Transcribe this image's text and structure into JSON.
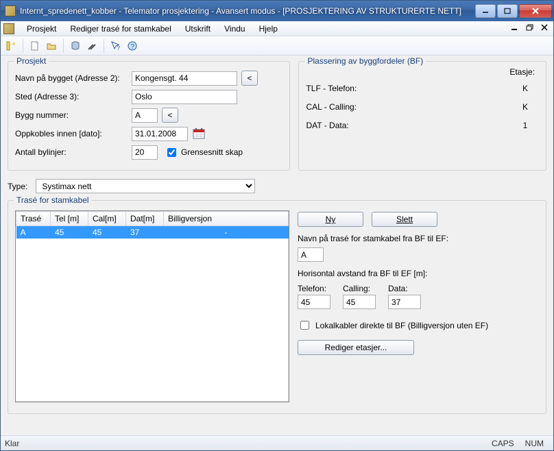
{
  "title": "Internt_spredenett_kobber - Telemator prosjektering - Avansert modus - [PROSJEKTERING AV STRUKTURERTE NETT]",
  "menu": {
    "items": [
      "Prosjekt",
      "Rediger trasé for stamkabel",
      "Utskrift",
      "Vindu",
      "Hjelp"
    ]
  },
  "project_group": {
    "title": "Prosjekt",
    "labels": {
      "navn": "Navn på bygget (Adresse 2):",
      "sted": "Sted (Adresse 3):",
      "byggnr": "Bygg nummer:",
      "oppkobles": "Oppkobles innen [dato]:",
      "antall": "Antall bylinjer:",
      "grensesnitt": "Grensesnitt skap",
      "back": "<"
    },
    "values": {
      "navn": "Kongensgt. 44",
      "sted": "Oslo",
      "byggnr": "A",
      "dato": "31.01.2008",
      "antall": "20",
      "grensesnitt_checked": true
    }
  },
  "bf_group": {
    "title": "Plassering av byggfordeler (BF)",
    "etasje_label": "Etasje:",
    "rows": [
      {
        "label": "TLF - Telefon:",
        "value": "K"
      },
      {
        "label": "CAL - Calling:",
        "value": "K"
      },
      {
        "label": "DAT - Data:",
        "value": "1"
      }
    ]
  },
  "type": {
    "label": "Type:",
    "value": "Systimax nett"
  },
  "trase_group": {
    "title": "Trasé for stamkabel",
    "columns": [
      "Trasé",
      "Tel [m]",
      "Cal[m]",
      "Dat[m]",
      "Billigversjon"
    ],
    "rows": [
      {
        "trase": "A",
        "tel": "45",
        "cal": "45",
        "dat": "37",
        "billig": "-"
      }
    ],
    "buttons": {
      "ny": "Ny",
      "slett": "Slett",
      "rediger": "Rediger etasjer..."
    },
    "navn_label": "Navn på trasé for stamkabel fra BF til EF:",
    "navn_value": "A",
    "avstand_label": "Horisontal avstand fra BF til EF [m]:",
    "cols": {
      "tel": "Telefon:",
      "cal": "Calling:",
      "dat": "Data:"
    },
    "vals": {
      "tel": "45",
      "cal": "45",
      "dat": "37"
    },
    "lokalkabler_label": "Lokalkabler direkte til BF (Billigversjon uten EF)",
    "lokalkabler_checked": false
  },
  "status": {
    "left": "Klar",
    "caps": "CAPS",
    "num": "NUM"
  },
  "icons": {
    "wizard": "wizard-icon",
    "new": "new-doc-icon",
    "open": "open-icon",
    "db": "database-icon",
    "tools": "tools-icon",
    "help1": "context-help-icon",
    "help2": "help-icon",
    "calendar": "calendar-icon"
  }
}
